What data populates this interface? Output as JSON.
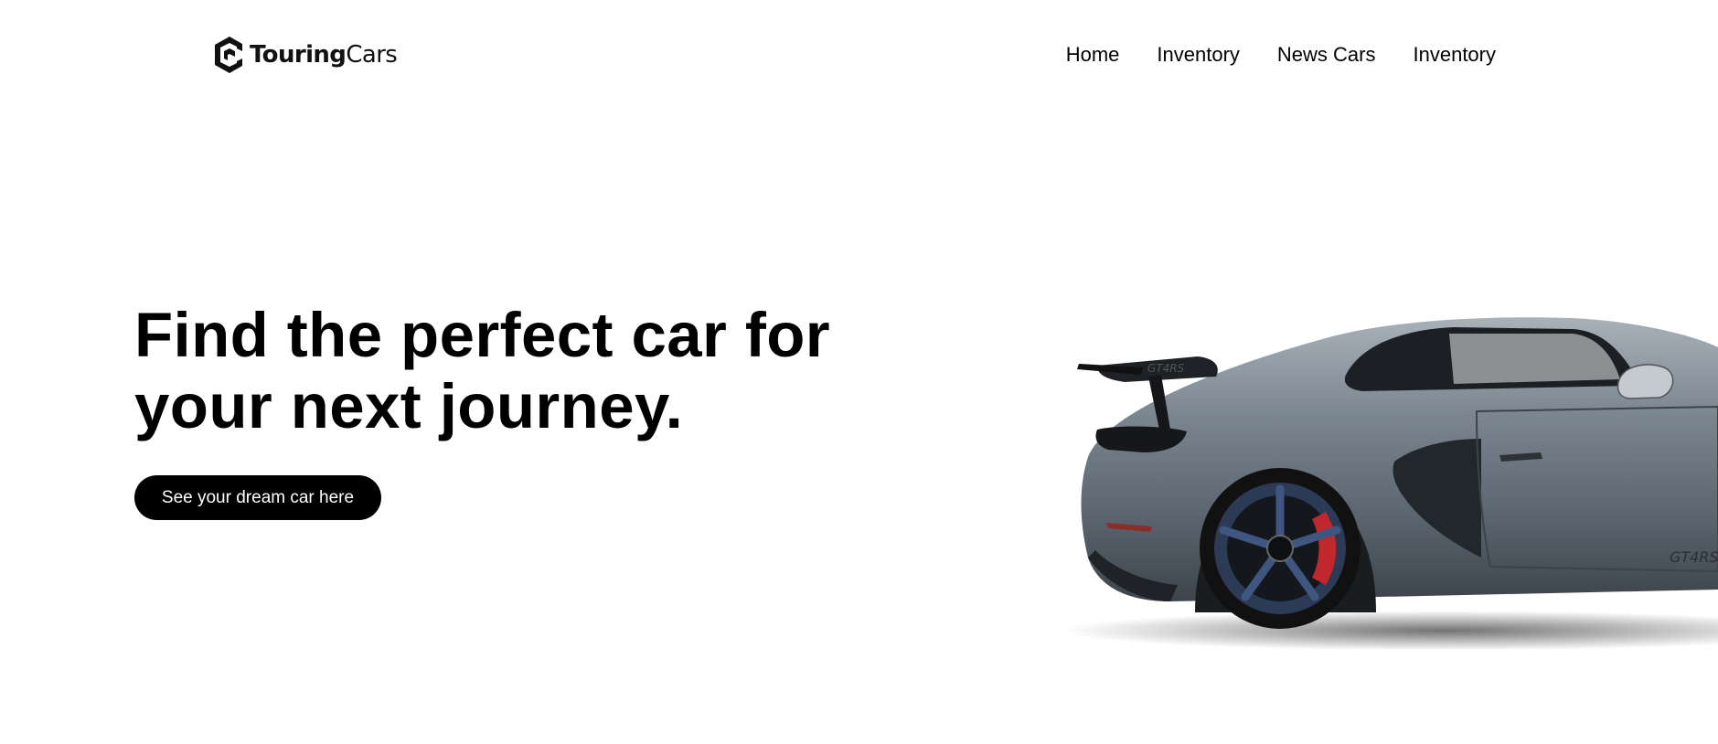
{
  "brand": {
    "name_bold": "Touring",
    "name_light": "Cars",
    "icon": "touringcars-logo-icon"
  },
  "nav": {
    "items": [
      {
        "label": "Home"
      },
      {
        "label": "Inventory"
      },
      {
        "label": "News Cars"
      },
      {
        "label": "Inventory"
      }
    ]
  },
  "hero": {
    "title": "Find the perfect car for your next journey.",
    "cta_label": "See your dream car here",
    "car_badge": "GT4RS"
  },
  "colors": {
    "cta_bg": "#000000",
    "cta_text": "#ffffff",
    "car_body": "#6f7a85",
    "wheel": "#2b3a55",
    "brake": "#c0282d"
  }
}
